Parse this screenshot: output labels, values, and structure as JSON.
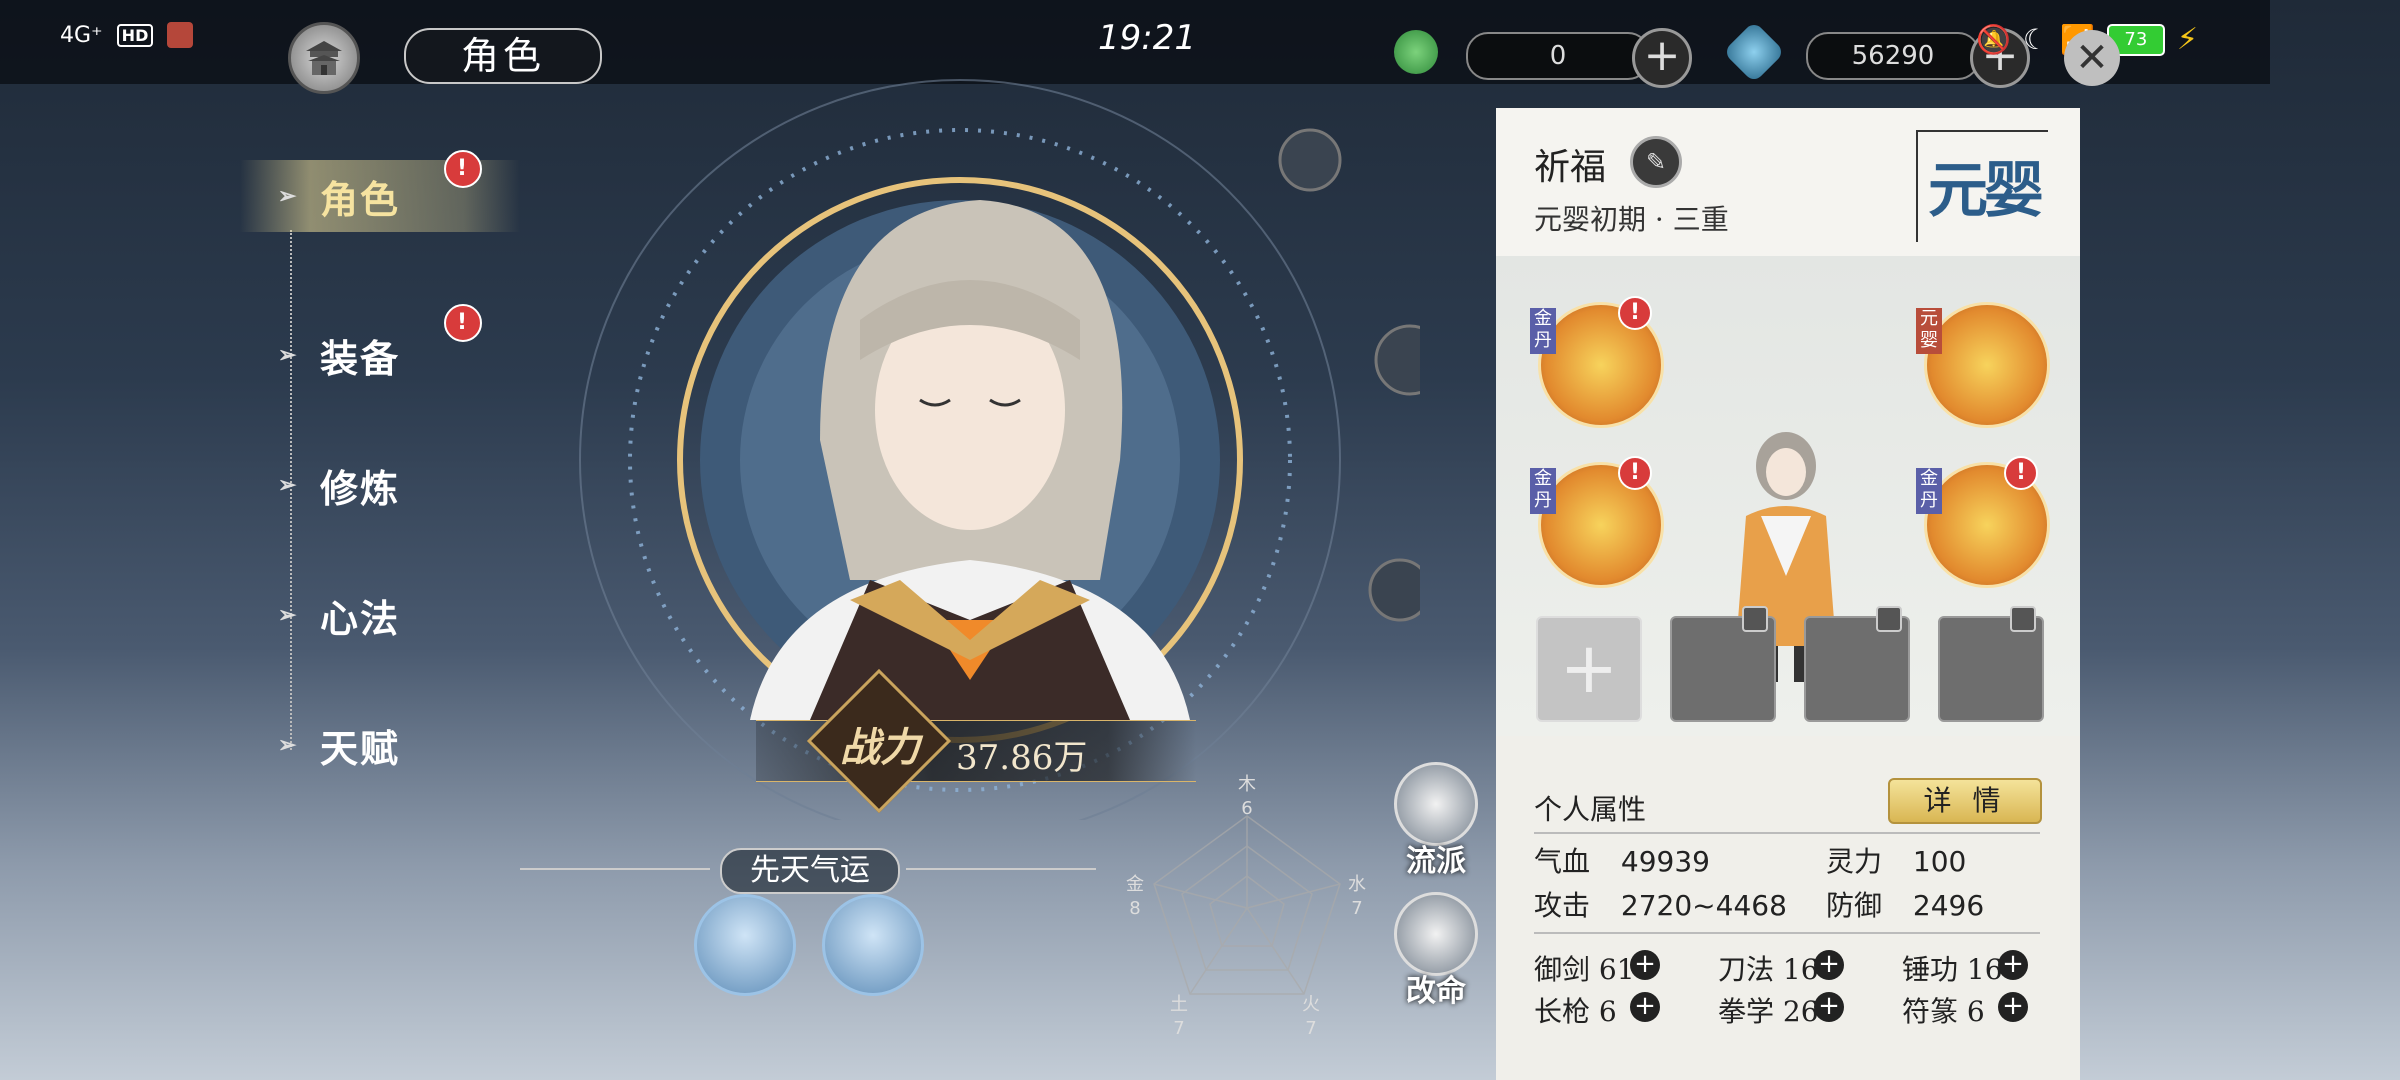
{
  "status_bar": {
    "network": "4G⁺",
    "hd": "HD",
    "battery": "73"
  },
  "header": {
    "title": "角色",
    "time": "19:21",
    "resource1": "0",
    "resource2": "56290"
  },
  "nav": {
    "items": [
      {
        "label": "角色",
        "badge": "!"
      },
      {
        "label": "装备",
        "badge": "!"
      },
      {
        "label": "修炼"
      },
      {
        "label": "心法"
      },
      {
        "label": "天赋"
      }
    ]
  },
  "portrait": {
    "power_label": "战力",
    "power_value": "37.86万"
  },
  "fortune": {
    "title": "先天气运"
  },
  "radar": {
    "labels": {
      "top": "木",
      "top_val": "6",
      "right": "水",
      "right_val": "7",
      "bottom_right": "火",
      "bottom_right_val": "7",
      "bottom_left": "土",
      "bottom_left_val": "7",
      "left": "金",
      "left_val": "8"
    }
  },
  "side_buttons": {
    "school": "流派",
    "fate": "改命"
  },
  "panel": {
    "name": "祈福",
    "realm": "元婴初期 · 三重",
    "realm_seal": "元婴",
    "books": [
      {
        "tag": "金丹",
        "badge": "!"
      },
      {
        "tag": "元婴"
      },
      {
        "tag": "金丹",
        "badge": "!"
      },
      {
        "tag": "金丹",
        "badge": "!"
      }
    ],
    "add_slot": "+",
    "attributes_title": "个人属性",
    "detail_button": "详 情",
    "stats": {
      "hp_label": "气血",
      "hp": "49939",
      "sp_label": "灵力",
      "sp": "100",
      "atk_label": "攻击",
      "atk": "2720~4468",
      "def_label": "防御",
      "def": "2496"
    },
    "skills": [
      {
        "name": "御剑",
        "value": "61"
      },
      {
        "name": "刀法",
        "value": "16"
      },
      {
        "name": "锤功",
        "value": "16"
      },
      {
        "name": "长枪",
        "value": "6"
      },
      {
        "name": "拳学",
        "value": "26"
      },
      {
        "name": "符篆",
        "value": "6"
      }
    ],
    "plus": "+"
  }
}
